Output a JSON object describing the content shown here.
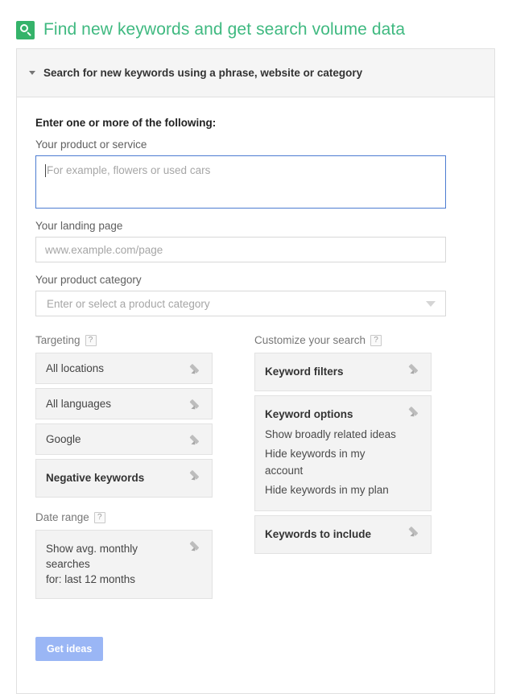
{
  "header": {
    "icon": "search-magnifier-icon",
    "title": "Find new keywords and get search volume data",
    "accent_color": "#3fb980",
    "icon_bg_color": "#35b36a"
  },
  "panel": {
    "collapse_icon": "chevron-down-icon",
    "header_label": "Search for new keywords using a phrase, website or category"
  },
  "form": {
    "heading": "Enter one or more of the following:",
    "product_service": {
      "label": "Your product or service",
      "placeholder": "For example, flowers or used cars",
      "value": "",
      "focused": true,
      "focus_border_color": "#4d7cd1"
    },
    "landing_page": {
      "label": "Your landing page",
      "placeholder": "www.example.com/page",
      "value": ""
    },
    "product_category": {
      "label": "Your product category",
      "placeholder": "Enter or select a product category",
      "value": "",
      "arrow_icon": "triangle-down-icon"
    }
  },
  "targeting": {
    "label": "Targeting",
    "help": "?",
    "items": [
      {
        "title": "All locations",
        "bold": false,
        "edit_icon": "pencil-icon"
      },
      {
        "title": "All languages",
        "bold": false,
        "edit_icon": "pencil-icon"
      },
      {
        "title": "Google",
        "bold": false,
        "edit_icon": "pencil-icon"
      },
      {
        "title": "Negative keywords",
        "bold": true,
        "edit_icon": "pencil-icon"
      }
    ]
  },
  "date_range": {
    "label": "Date range",
    "help": "?",
    "line1": "Show avg. monthly searches",
    "line2": "for: last 12 months",
    "edit_icon": "pencil-icon"
  },
  "customize": {
    "label": "Customize your search",
    "help": "?",
    "keyword_filters": {
      "title": "Keyword filters",
      "edit_icon": "pencil-icon"
    },
    "keyword_options": {
      "title": "Keyword options",
      "edit_icon": "pencil-icon",
      "options": [
        "Show broadly related ideas",
        "Hide keywords in my account",
        "Hide keywords in my plan"
      ]
    },
    "keywords_to_include": {
      "title": "Keywords to include",
      "edit_icon": "pencil-icon"
    }
  },
  "actions": {
    "get_ideas_label": "Get ideas",
    "get_ideas_color": "#9ab6f5",
    "get_ideas_disabled": true
  }
}
